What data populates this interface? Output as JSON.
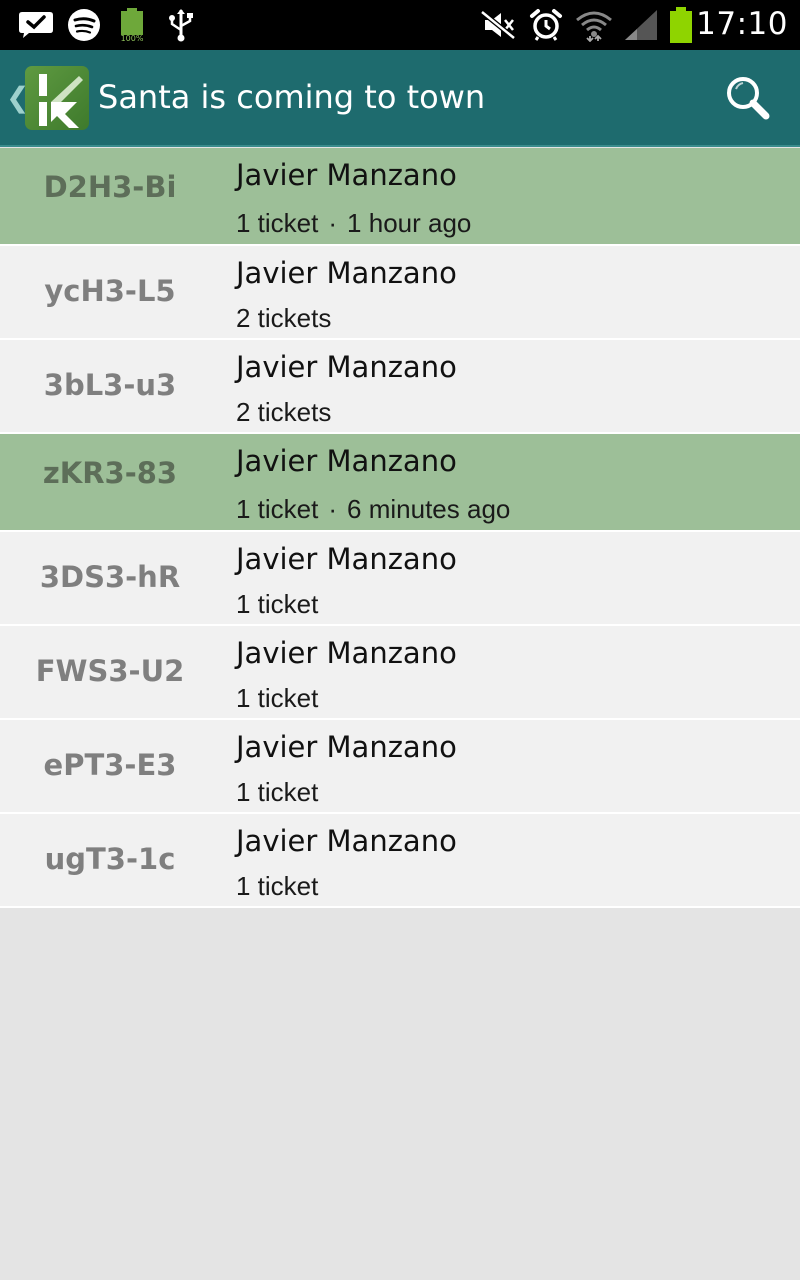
{
  "status_bar": {
    "time": "17:10",
    "battery_small_label": "100%",
    "icons": [
      "check-bubble-icon",
      "spotify-icon",
      "battery-full-small-icon",
      "usb-icon",
      "mute-icon",
      "alarm-icon",
      "wifi-icon",
      "signal-icon",
      "battery-icon"
    ]
  },
  "action_bar": {
    "title": "Santa is coming to town",
    "logo_letter": "K",
    "back_icon": "chevron-left-icon",
    "search_icon": "search-icon"
  },
  "tickets": [
    {
      "code": "D2H3-Bi",
      "name": "Javier Manzano",
      "count": "1 ticket",
      "time": "1 hour ago",
      "highlight": true
    },
    {
      "code": "ycH3-L5",
      "name": "Javier Manzano",
      "count": "2 tickets",
      "time": "",
      "highlight": false
    },
    {
      "code": "3bL3-u3",
      "name": "Javier Manzano",
      "count": "2 tickets",
      "time": "",
      "highlight": false
    },
    {
      "code": "zKR3-83",
      "name": "Javier Manzano",
      "count": "1 ticket",
      "time": "6 minutes ago",
      "highlight": true
    },
    {
      "code": "3DS3-hR",
      "name": "Javier Manzano",
      "count": "1 ticket",
      "time": "",
      "highlight": false
    },
    {
      "code": "FWS3-U2",
      "name": "Javier Manzano",
      "count": "1 ticket",
      "time": "",
      "highlight": false
    },
    {
      "code": "ePT3-E3",
      "name": "Javier Manzano",
      "count": "1 ticket",
      "time": "",
      "highlight": false
    },
    {
      "code": "ugT3-1c",
      "name": "Javier Manzano",
      "count": "1 ticket",
      "time": "",
      "highlight": false
    }
  ],
  "colors": {
    "action_bar": "#1e6b6e",
    "highlight_row": "#9dbf98",
    "row": "#f1f1f1",
    "background": "#e4e4e4"
  }
}
